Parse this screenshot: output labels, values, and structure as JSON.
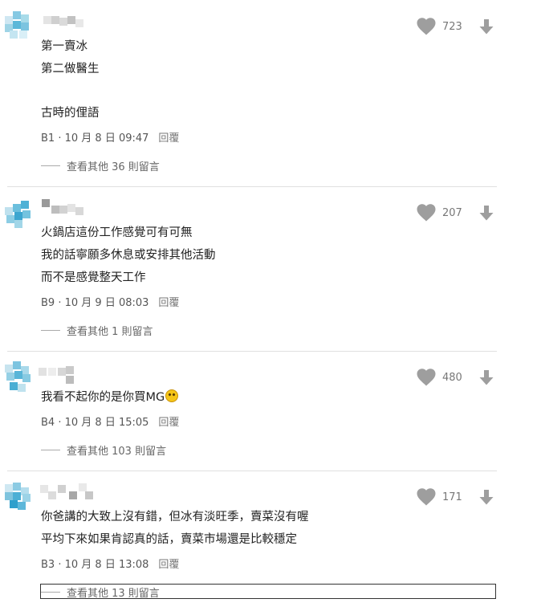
{
  "colors": {
    "icon": "#9e9e9e",
    "divider": "#e0e0e0",
    "text": "#212121",
    "meta": "#555555"
  },
  "icons": {
    "like": "heart-icon",
    "dislike": "arrow-down-icon",
    "reaction": "rofl-emoji-icon"
  },
  "comments": [
    {
      "lines": [
        "第一賣冰",
        "第二做醫生",
        "",
        "古時的俚語"
      ],
      "floor": "B1",
      "date": "10 月 8 日 09:47",
      "reply_label": "回覆",
      "likes": "723",
      "replies_label": "查看其他 36 則留言"
    },
    {
      "lines": [
        "火鍋店這份工作感覺可有可無",
        "我的話寧願多休息或安排其他活動",
        "而不是感覺整天工作"
      ],
      "floor": "B9",
      "date": "10 月 9 日 08:03",
      "reply_label": "回覆",
      "likes": "207",
      "replies_label": "查看其他 1 則留言"
    },
    {
      "lines": [
        "我看不起你的是你買MG"
      ],
      "floor": "B4",
      "date": "10 月 8 日 15:05",
      "reply_label": "回覆",
      "likes": "480",
      "replies_label": "查看其他 103 則留言"
    },
    {
      "lines": [
        "你爸講的大致上沒有錯，但冰有淡旺季，賣菜沒有喔",
        "平均下來如果肯認真的話，賣菜市場還是比較穩定"
      ],
      "floor": "B3",
      "date": "10 月 8 日 13:08",
      "reply_label": "回覆",
      "likes": "171",
      "replies_label": "查看其他 13 則留言"
    }
  ]
}
